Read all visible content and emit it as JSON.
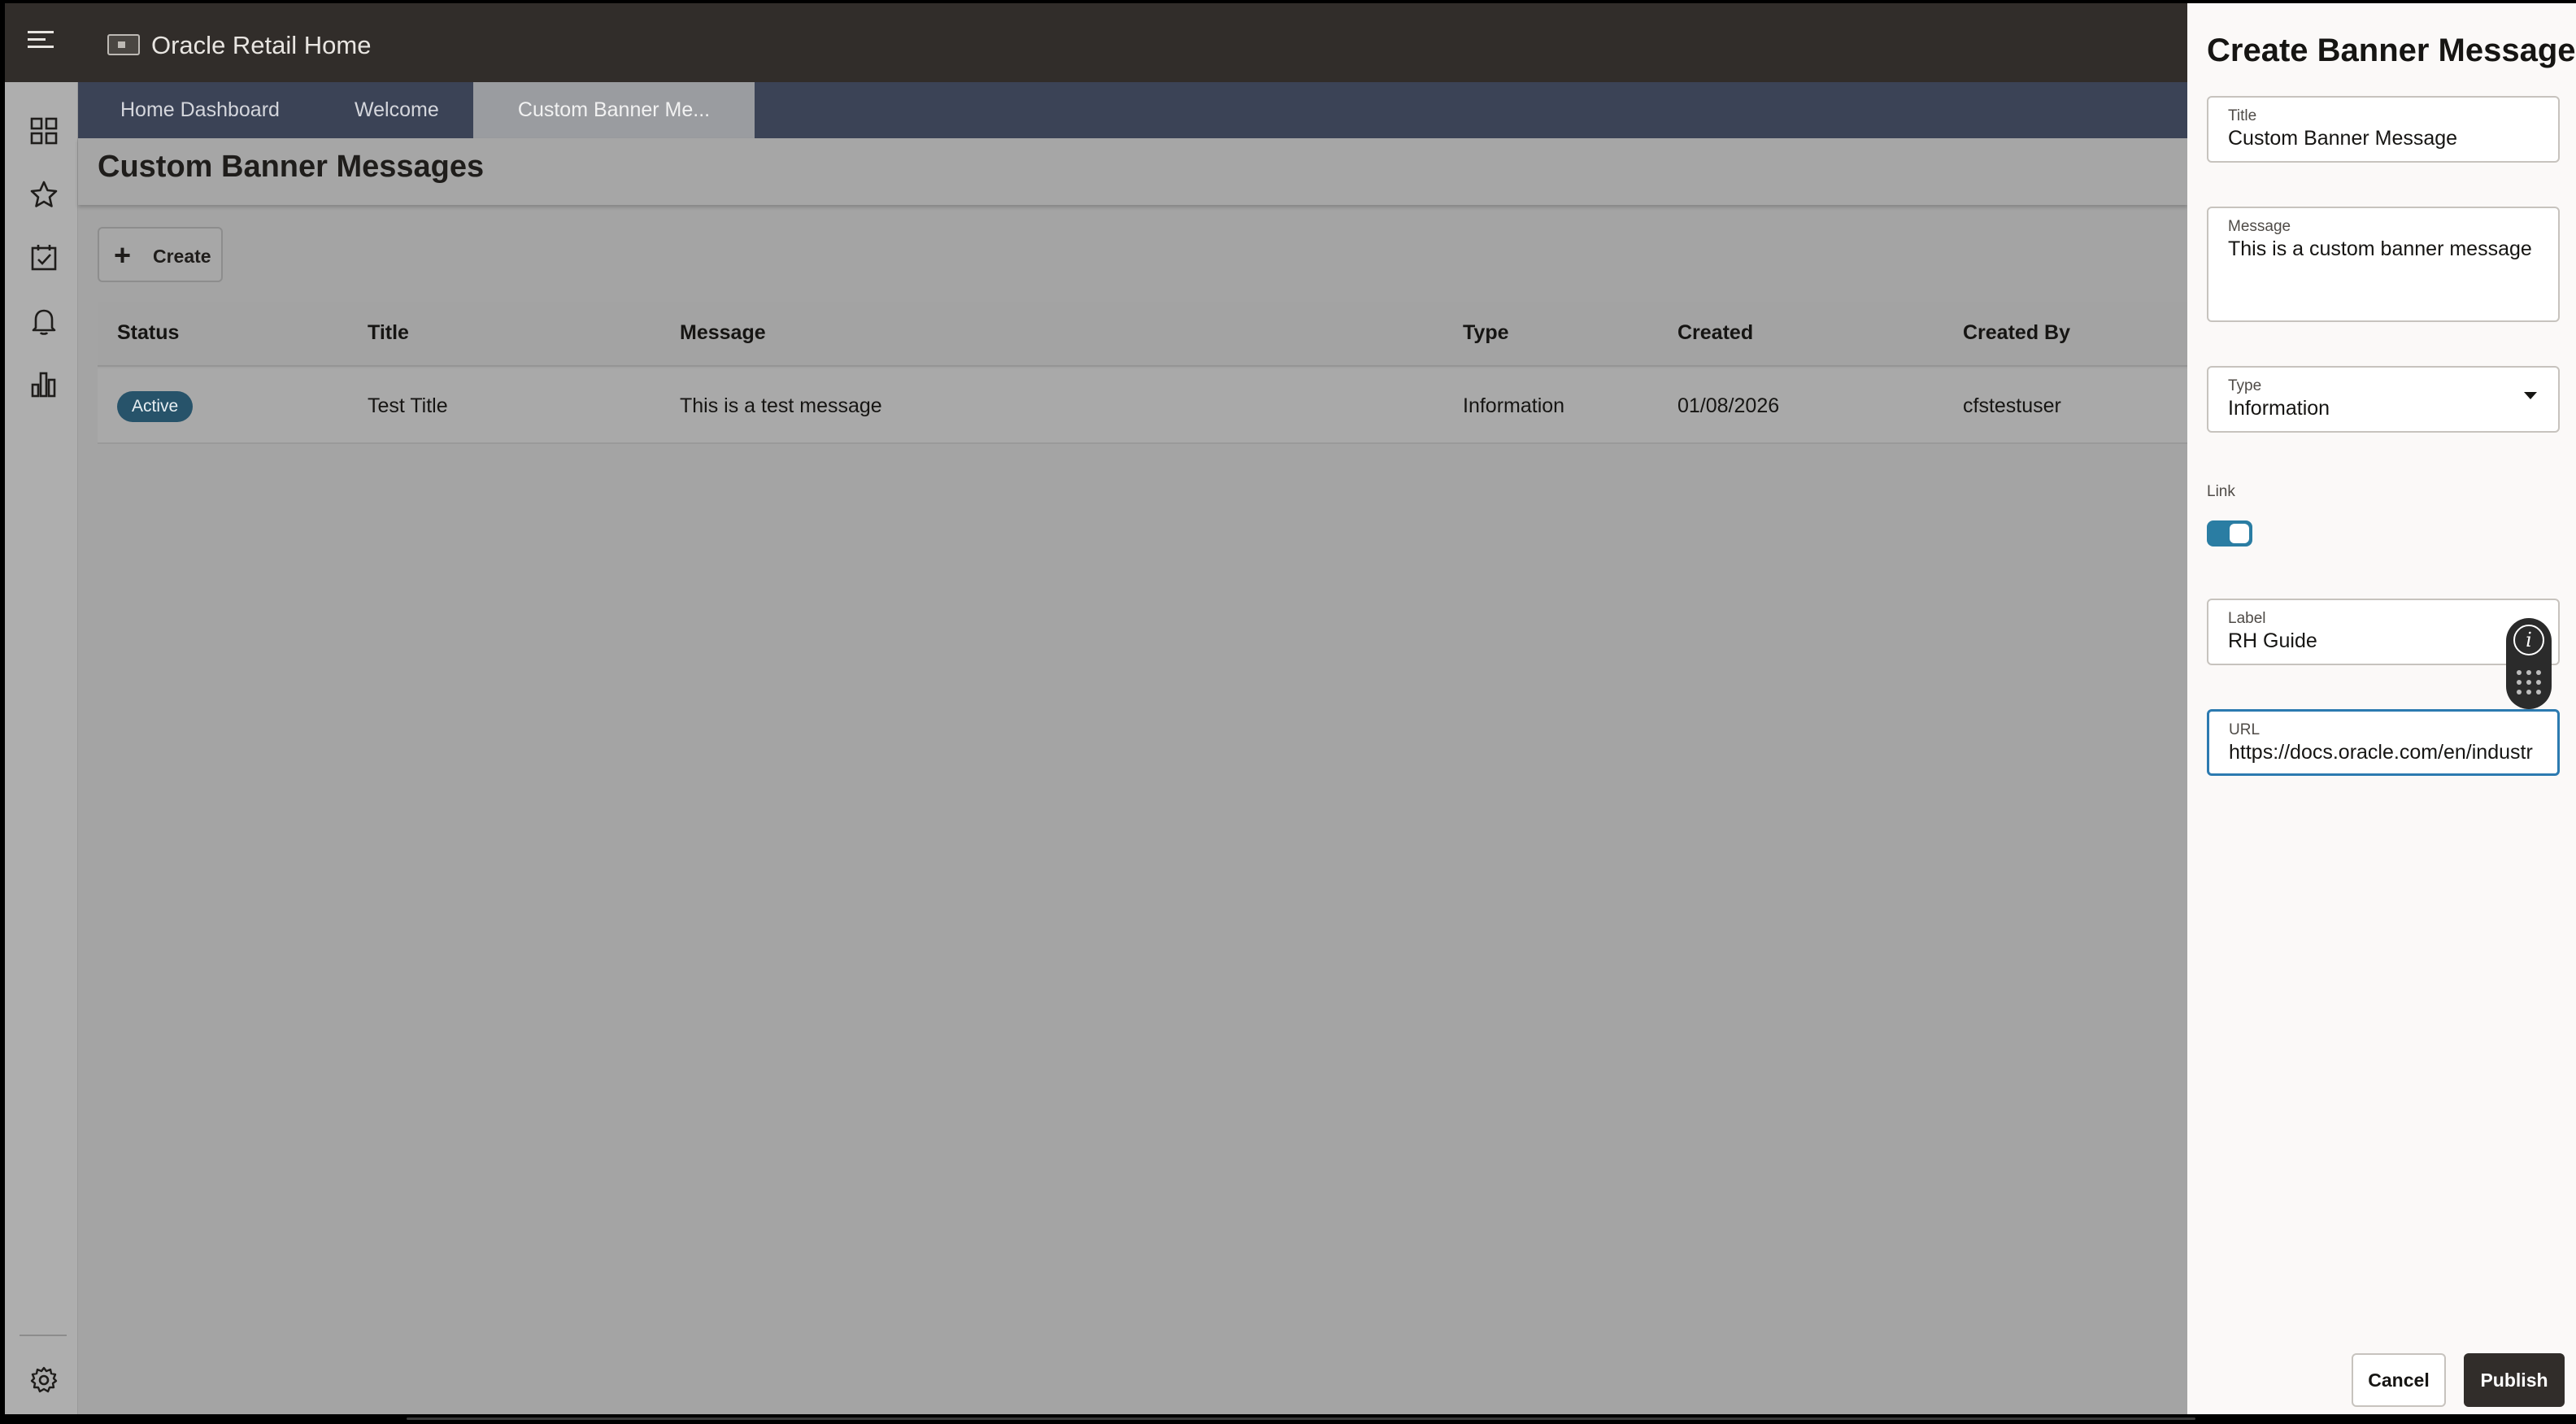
{
  "header": {
    "app_title": "Oracle Retail Home"
  },
  "sidebar": {
    "items": [
      {
        "icon": "dashboard-grid-icon"
      },
      {
        "icon": "star-icon"
      },
      {
        "icon": "task-checkbox-icon"
      },
      {
        "icon": "bell-icon"
      },
      {
        "icon": "bar-chart-icon"
      }
    ],
    "bottom_icon": "gear-icon"
  },
  "tabs": [
    {
      "label": "Home Dashboard",
      "active": false
    },
    {
      "label": "Welcome",
      "active": false
    },
    {
      "label": "Custom Banner Me...",
      "active": true
    }
  ],
  "main": {
    "page_title": "Custom Banner Messages",
    "create_label": "Create",
    "table": {
      "columns": [
        "Status",
        "Title",
        "Message",
        "Type",
        "Created",
        "Created By"
      ],
      "rows": [
        {
          "status": "Active",
          "title": "Test Title",
          "message": "This is a test message",
          "type": "Information",
          "created": "01/08/2026",
          "created_by": "cfstestuser"
        }
      ]
    }
  },
  "panel": {
    "title": "Create Banner Message",
    "fields": {
      "title": {
        "label": "Title",
        "value": "Custom Banner Message"
      },
      "message": {
        "label": "Message",
        "value": "This is a custom banner message"
      },
      "type": {
        "label": "Type",
        "value": "Information"
      },
      "link": {
        "label": "Link",
        "enabled": true
      },
      "label": {
        "label": "Label",
        "value": "RH Guide"
      },
      "url": {
        "label": "URL",
        "value": "https://docs.oracle.com/en/industr"
      }
    },
    "cancel_label": "Cancel",
    "publish_label": "Publish"
  },
  "colors": {
    "header_bg": "#312d2a",
    "tab_bar_bg": "#3b4356",
    "badge_bg": "#27536a",
    "toggle_on": "#2a7da3",
    "focus_border": "#2c7ab0",
    "publish_bg": "#312d2a"
  }
}
